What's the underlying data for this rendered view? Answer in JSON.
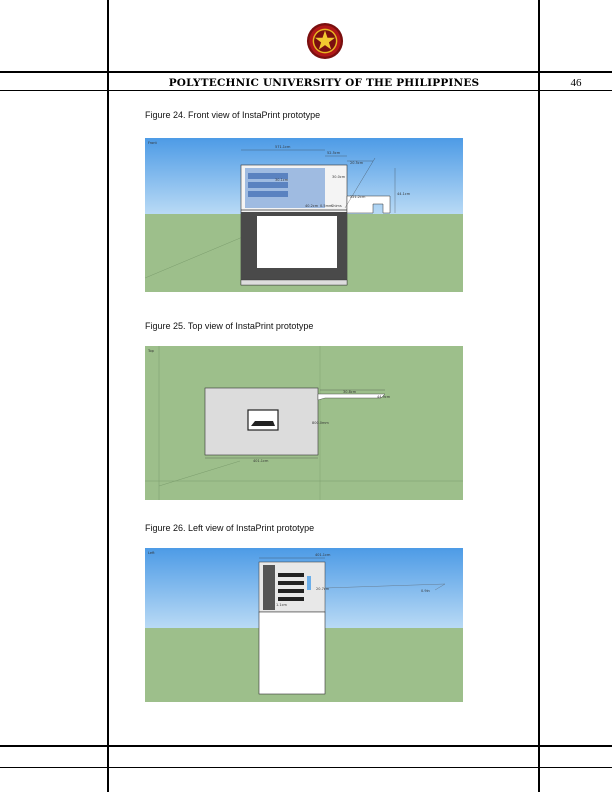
{
  "header": {
    "university": "POLYTECHNIC UNIVERSITY OF THE PHILIPPINES",
    "page_number": "46"
  },
  "figures": [
    {
      "caption": "Figure 24. Front view of InstaPrint prototype",
      "view_label": "Front",
      "dims": [
        "571.1cm",
        "52.5cm",
        "20.5cm",
        "30.0cm",
        "30.1cm",
        "221.2cm",
        "44.1cm",
        "40.2cm",
        "0.5mm",
        "Shims"
      ]
    },
    {
      "caption": "Figure 25. Top view of InstaPrint prototype",
      "view_label": "Top",
      "dims": [
        "30.8cm",
        "44.9cm",
        "800.0mm",
        "401.1cm"
      ]
    },
    {
      "caption": "Figure 26. Left view of InstaPrint prototype",
      "view_label": "Left",
      "dims": [
        "401.1cm",
        "20.7cm",
        "0.9in",
        "1.1cm"
      ]
    }
  ],
  "colors": {
    "sky": "#6aaeea",
    "ground": "#9dbf8b",
    "rule": "#000000",
    "seal_red": "#b01818",
    "seal_gold": "#e8b820"
  }
}
